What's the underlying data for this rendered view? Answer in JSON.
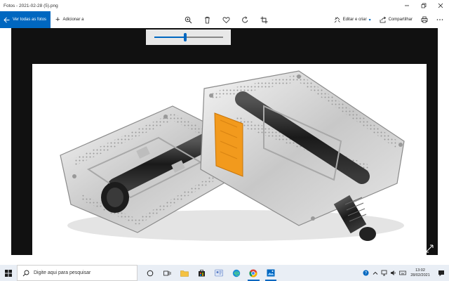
{
  "window": {
    "title": "Fotos - 2021-02-28 (5).png",
    "controls": [
      "minimize",
      "maximize",
      "close"
    ]
  },
  "toolbar": {
    "see_all_label": "Ver todas as fotos",
    "add_label": "Adicionar a",
    "tools": [
      "zoom-icon",
      "delete-icon",
      "favorite-icon",
      "rotate-icon",
      "crop-icon"
    ],
    "edit_label": "Editar e criar",
    "share_label": "Compartilhar",
    "print_icon": "print-icon",
    "more_icon": "more-icon"
  },
  "viewer": {
    "zoom_fraction": 0.45,
    "photo_subject": "bicycle-pedals-image"
  },
  "taskbar": {
    "search_placeholder": "Digite aqui para pesquisar",
    "apps": [
      "task-view",
      "widgets",
      "file-explorer",
      "store",
      "teams",
      "edge",
      "chrome",
      "photos"
    ],
    "time": "13:02",
    "date": "28/02/2021"
  },
  "colors": {
    "accent": "#0067c0",
    "canvas": "#111111",
    "reflector": "#f29a1d"
  }
}
